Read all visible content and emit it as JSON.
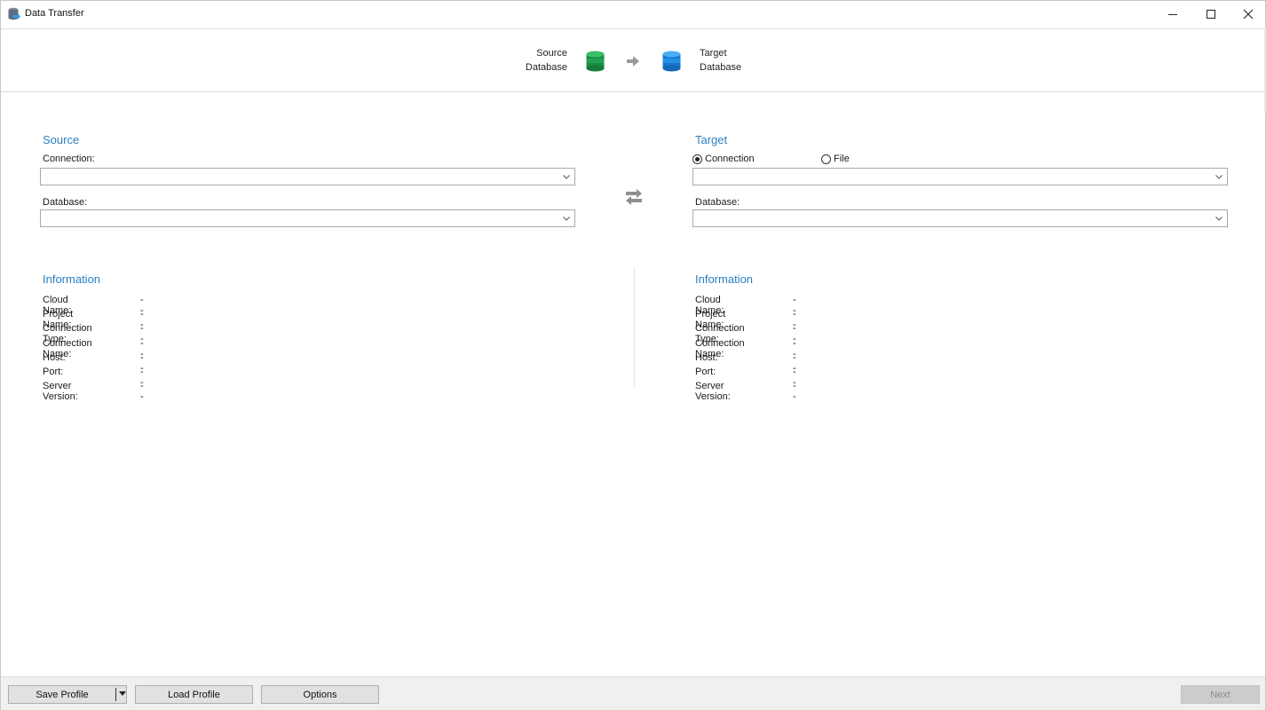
{
  "window": {
    "title": "Data Transfer",
    "icon": "data-transfer-app-icon",
    "controls": {
      "minimize": "minimize-icon",
      "maximize": "maximize-icon",
      "close": "close-icon"
    }
  },
  "banner": {
    "source_line1": "Source",
    "source_line2": "Database",
    "target_line1": "Target",
    "target_line2": "Database",
    "colors": {
      "source_db": "#1e9a4c",
      "target_db": "#1f86e0",
      "arrow": "#9a9a9a"
    }
  },
  "source": {
    "title": "Source",
    "connection_label": "Connection:",
    "connection_value": "",
    "database_label": "Database:",
    "database_value": ""
  },
  "target": {
    "title": "Target",
    "mode_options": [
      {
        "label": "Connection",
        "selected": true
      },
      {
        "label": "File",
        "selected": false
      }
    ],
    "connection_value": "",
    "database_label": "Database:",
    "database_value": ""
  },
  "source_info": {
    "title": "Information",
    "rows": [
      {
        "key": "Cloud Name:",
        "value": "--"
      },
      {
        "key": "Project Name:",
        "value": "--"
      },
      {
        "key": "Connection Type:",
        "value": "--"
      },
      {
        "key": "Connection Name:",
        "value": "--"
      },
      {
        "key": "Host:",
        "value": "--"
      },
      {
        "key": "Port:",
        "value": "--"
      },
      {
        "key": "Server Version:",
        "value": "--"
      }
    ]
  },
  "target_info": {
    "title": "Information",
    "rows": [
      {
        "key": "Cloud Name:",
        "value": "--"
      },
      {
        "key": "Project Name:",
        "value": "--"
      },
      {
        "key": "Connection Type:",
        "value": "--"
      },
      {
        "key": "Connection Name:",
        "value": "--"
      },
      {
        "key": "Host:",
        "value": "--"
      },
      {
        "key": "Port:",
        "value": "--"
      },
      {
        "key": "Server Version:",
        "value": "--"
      }
    ]
  },
  "footer": {
    "save_profile": "Save Profile",
    "load_profile": "Load Profile",
    "options": "Options",
    "next": "Next",
    "next_enabled": false
  },
  "theme": {
    "accent": "#2b7fc1"
  }
}
